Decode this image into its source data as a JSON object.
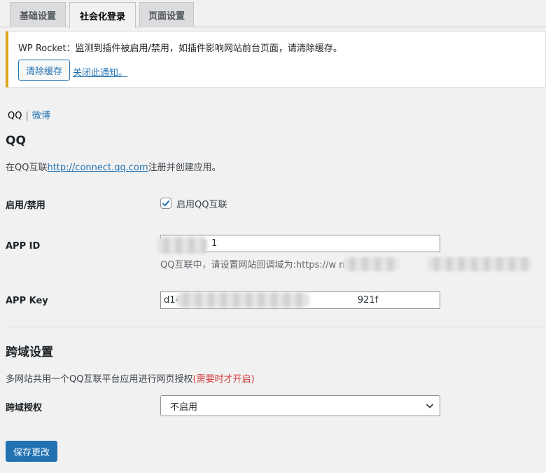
{
  "tabs": [
    {
      "label": "基础设置"
    },
    {
      "label": "社会化登录"
    },
    {
      "label": "页面设置"
    }
  ],
  "notice": {
    "text": "WP Rocket：监测到插件被启用/禁用，如插件影响网站前台页面，请清除缓存。",
    "button": "清除缓存",
    "link": "关闭此通知。",
    "border_color": "#dba617"
  },
  "subnav": {
    "current": "QQ",
    "separator": "|",
    "other": "微博"
  },
  "qq_section": {
    "title": "QQ",
    "desc_prefix": "在QQ互联",
    "desc_link": "http://connect.qq.com",
    "desc_suffix": "注册并创建应用。",
    "enable_label": "启用/禁用",
    "enable_checkbox_label": "启用QQ互联",
    "enable_checked": true,
    "appid_label": "APP ID",
    "appid_value": "1",
    "appid_hint": "QQ互联中，请设置网站回调域为:https://w                 n.com/                                      p",
    "appkey_label": "APP Key",
    "appkey_value": "d14                                                             921f"
  },
  "cross_section": {
    "title": "跨域设置",
    "desc": "多网站共用一个QQ互联平台应用进行网页授权",
    "desc_note": "(需要时才开启)",
    "label": "跨域授权",
    "select_value": "不启用"
  },
  "save_button": "保存更改",
  "colors": {
    "primary": "#2271b1",
    "note_red": "#d63638",
    "background": "#f1f1f1"
  }
}
